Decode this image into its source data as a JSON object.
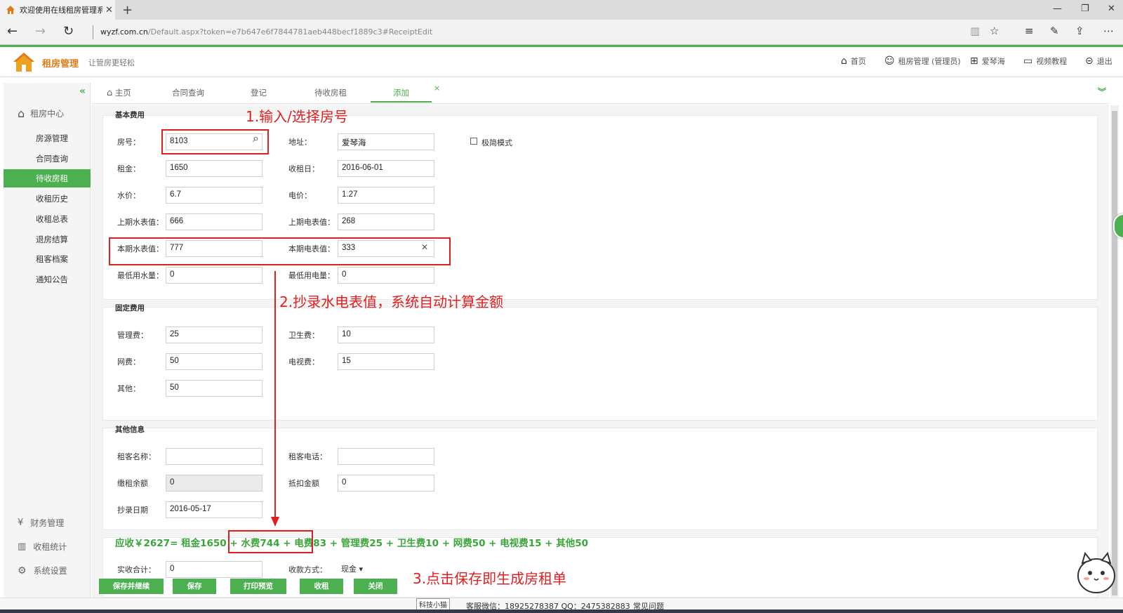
{
  "browser": {
    "tab_title": "欢迎使用在线租房管理系",
    "tab_close": "✕",
    "new_tab": "+",
    "url_domain": "wyzf.com.cn",
    "url_path": "/Default.aspx?token=e7b647e6f7844781aeb448becf1889c3#ReceiptEdit"
  },
  "header": {
    "brand": "租房管理",
    "slogan": "让管房更轻松",
    "nav": {
      "home": "首页",
      "user": "租房管理 (管理员)",
      "org": "爱琴海",
      "video": "视频教程",
      "logout": "退出"
    }
  },
  "sidebar": {
    "collapse": "«",
    "group": "租房中心",
    "items": [
      "房源管理",
      "合同查询",
      "待收房租",
      "收租历史",
      "收租总表",
      "退房结算",
      "租客档案",
      "通知公告"
    ],
    "active_index": 2,
    "bottom": [
      "财务管理",
      "收租统计",
      "系统设置"
    ]
  },
  "tabs": {
    "home": "主页",
    "items": [
      "合同查询",
      "登记",
      "待收房租",
      "添加"
    ],
    "close": "×",
    "expand": "»"
  },
  "sections": {
    "basic": "基本费用",
    "fixed": "固定费用",
    "other": "其他信息"
  },
  "form": {
    "room_no_label": "房号：",
    "room_no": "8103",
    "address_label": "地址：",
    "address": "爱琴海",
    "simple_mode": "极简模式",
    "rent_label": "租金：",
    "rent": "1650",
    "rent_day_label": "收租日：",
    "rent_day": "2016-06-01",
    "water_price_label": "水价：",
    "water_price": "6.7",
    "elec_price_label": "电价：",
    "elec_price": "1.27",
    "prev_water_label": "上期水表值：",
    "prev_water": "666",
    "prev_elec_label": "上期电表值：",
    "prev_elec": "268",
    "cur_water_label": "本期水表值：",
    "cur_water": "777",
    "cur_elec_label": "本期电表值：",
    "cur_elec": "333",
    "min_water_label": "最低用水量：",
    "min_water": "0",
    "min_elec_label": "最低用电量：",
    "min_elec": "0",
    "mgmt_label": "管理费：",
    "mgmt": "25",
    "sanitation_label": "卫生费：",
    "sanitation": "10",
    "net_label": "网费：",
    "net": "50",
    "tv_label": "电视费：",
    "tv": "15",
    "misc_label": "其他：",
    "misc": "50",
    "tenant_name_label": "租客名称：",
    "tenant_name": "",
    "tenant_phone_label": "租客电话：",
    "tenant_phone": "",
    "balance_label": "缴租余额",
    "balance": "0",
    "deduct_label": "抵扣金额",
    "deduct": "0",
    "read_date_label": "抄录日期",
    "read_date": "2016-05-17",
    "actual_total_label": "实收合计：",
    "actual_total": "0",
    "pay_method_label": "收款方式：",
    "pay_method": "现金"
  },
  "summary": {
    "part1": "应收￥2627= 租金1650 + ",
    "part2": "水费744 + 电费83",
    "part3": " + 管理费25 + 卫生费10 + 网费50 + 电视费15 + 其他50"
  },
  "annotations": {
    "step1": "1.输入/选择房号",
    "step2": "2.抄录水电表值，系统自动计算金额",
    "step3": "3.点击保存即生成房租单"
  },
  "buttons": [
    "保存并继续",
    "保存",
    "打印预览",
    "收租",
    "关闭"
  ],
  "footer": {
    "tooltip": "科技小猫",
    "service": "客服微信：18925278387  QQ：2475382883",
    "faq": "常见问题"
  },
  "colors": {
    "accent": "#4caf50",
    "annotation": "#e02020",
    "brand": "#e07b1a"
  }
}
